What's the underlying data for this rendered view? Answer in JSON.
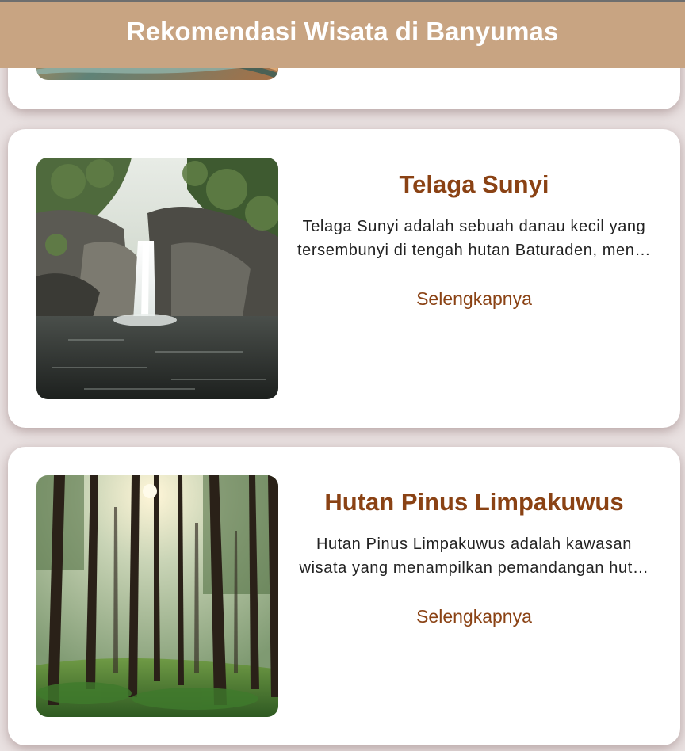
{
  "appbar": {
    "title": "Rekomendasi Wisata di Banyumas",
    "color": "#c8a482"
  },
  "cards": [
    {
      "image": "colorful-abstract-photo",
      "title": "",
      "desc_line1": "",
      "desc_line2": "",
      "more_label": ""
    },
    {
      "image": "waterfall-lake-photo",
      "title": "Telaga Sunyi",
      "desc_line1": "Telaga Sunyi adalah sebuah danau kecil yang",
      "desc_line2": "tersembunyi di tengah hutan Baturaden, men…",
      "more_label": "Selengkapnya"
    },
    {
      "image": "pine-forest-photo",
      "title": "Hutan Pinus Limpakuwus",
      "desc_line1": "Hutan Pinus Limpakuwus adalah kawasan",
      "desc_line2": "wisata yang menampilkan pemandangan hut…",
      "more_label": "Selengkapnya"
    }
  ],
  "colors": {
    "accent_text": "#8a4214",
    "background": "#e9e1e1",
    "card": "#ffffff"
  }
}
